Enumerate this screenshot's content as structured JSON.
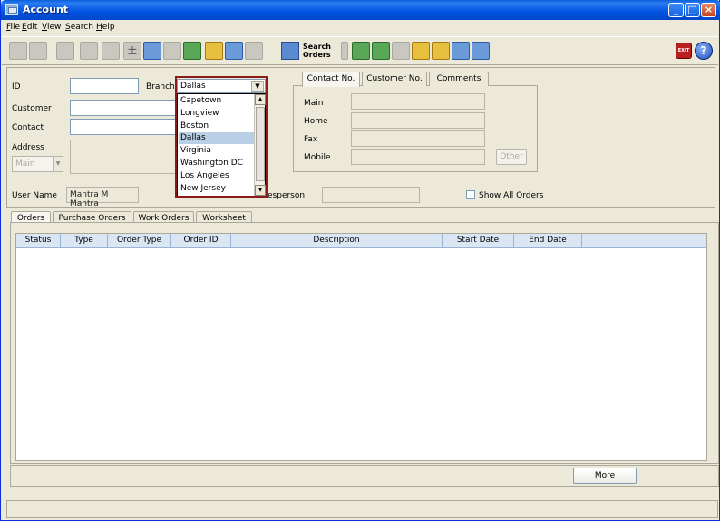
{
  "window": {
    "title": "Account"
  },
  "menu": [
    "File",
    "Edit",
    "View",
    "Search",
    "Help"
  ],
  "toolbar": {
    "search_orders_label_1": "Search",
    "search_orders_label_2": "Orders",
    "exit_label": "EXIT",
    "help_label": "?"
  },
  "form": {
    "id_label": "ID",
    "id_value": "",
    "branch_label": "Branch",
    "branch_value": "Dallas",
    "customer_label": "Customer",
    "contact_label": "Contact",
    "address_label": "Address",
    "address_type": "Main",
    "user_name_label": "User Name",
    "user_name_value": "Mantra M Mantra",
    "salesperson_label": "esperson",
    "show_all_orders_label": "Show All Orders",
    "show_all_orders_checked": false
  },
  "branch_options": [
    "Capetown",
    "Longview",
    "Boston",
    "Dallas",
    "Virginia",
    "Washington DC",
    "Los Angeles",
    "New Jersey"
  ],
  "branch_selected_index": 3,
  "contact_tabs": [
    "Contact No.",
    "Customer No.",
    "Comments"
  ],
  "contact": {
    "main_label": "Main",
    "home_label": "Home",
    "fax_label": "Fax",
    "mobile_label": "Mobile",
    "other_button": "Other"
  },
  "order_tabs": [
    "Orders",
    "Purchase Orders",
    "Work Orders",
    "Worksheet"
  ],
  "orders_table": {
    "columns": [
      "Status",
      "Type",
      "Order Type",
      "Order ID",
      "Description",
      "Start Date",
      "End Date"
    ],
    "rows": []
  },
  "more_button": "More",
  "colors": {
    "title_bar": "#0054e3",
    "selection": "#b8cfe5",
    "header": "#dbe6f4",
    "focus_ring": "#8b1a1a"
  }
}
